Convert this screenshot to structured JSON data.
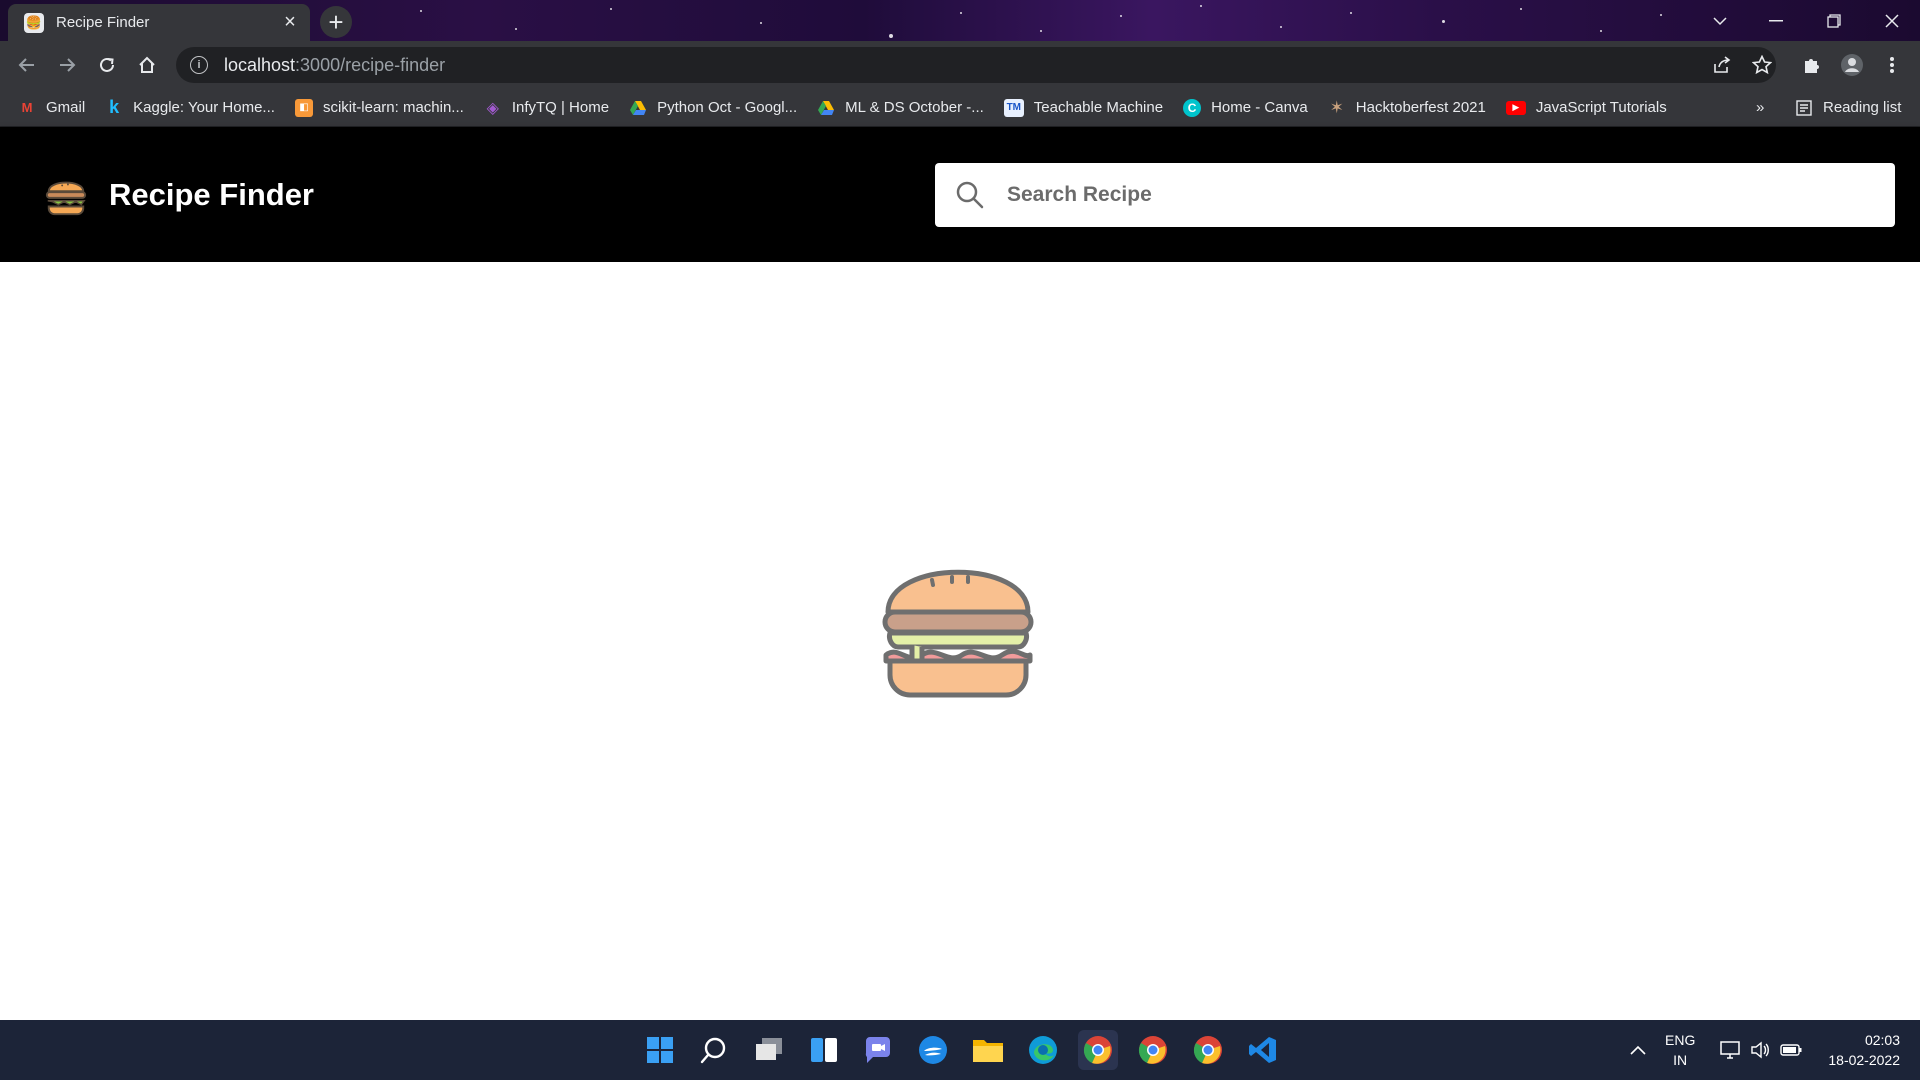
{
  "browser": {
    "tab_title": "Recipe Finder",
    "new_tab_symbol": "+",
    "url_host": "localhost",
    "url_path": ":3000/recipe-finder",
    "reading_list_label": "Reading list",
    "overflow_label": "»"
  },
  "bookmarks": [
    {
      "label": "Gmail",
      "icon": "gmail-icon",
      "color": "#ea4335",
      "glyph": "M"
    },
    {
      "label": "Kaggle: Your Home...",
      "icon": "kaggle-icon",
      "color": "#20beff",
      "glyph": "k"
    },
    {
      "label": "scikit-learn: machin...",
      "icon": "scikit-learn-icon",
      "color": "#f89939",
      "glyph": "◧"
    },
    {
      "label": "InfyTQ | Home",
      "icon": "infytq-icon",
      "color": "#8e44ad",
      "glyph": "◈"
    },
    {
      "label": "Python Oct - Googl...",
      "icon": "google-drive-icon",
      "color": "#fbbc04",
      "glyph": "▲"
    },
    {
      "label": "ML & DS October -...",
      "icon": "google-drive-icon",
      "color": "#34a853",
      "glyph": "▲"
    },
    {
      "label": "Teachable Machine",
      "icon": "teachable-machine-icon",
      "color": "#4285f4",
      "glyph": "TM"
    },
    {
      "label": "Home - Canva",
      "icon": "canva-icon",
      "color": "#00c4cc",
      "glyph": "C"
    },
    {
      "label": "Hacktoberfest 2021",
      "icon": "hacktoberfest-icon",
      "color": "#c9a27e",
      "glyph": "✶"
    },
    {
      "label": "JavaScript Tutorials",
      "icon": "youtube-icon",
      "color": "#ff0000",
      "glyph": "▶"
    }
  ],
  "app": {
    "name": "Recipe Finder",
    "search_placeholder": "Search Recipe",
    "accent_color": "#000000"
  },
  "taskbar": {
    "lang_top": "ENG",
    "lang_bottom": "IN",
    "time": "02:03",
    "date": "18-02-2022"
  }
}
